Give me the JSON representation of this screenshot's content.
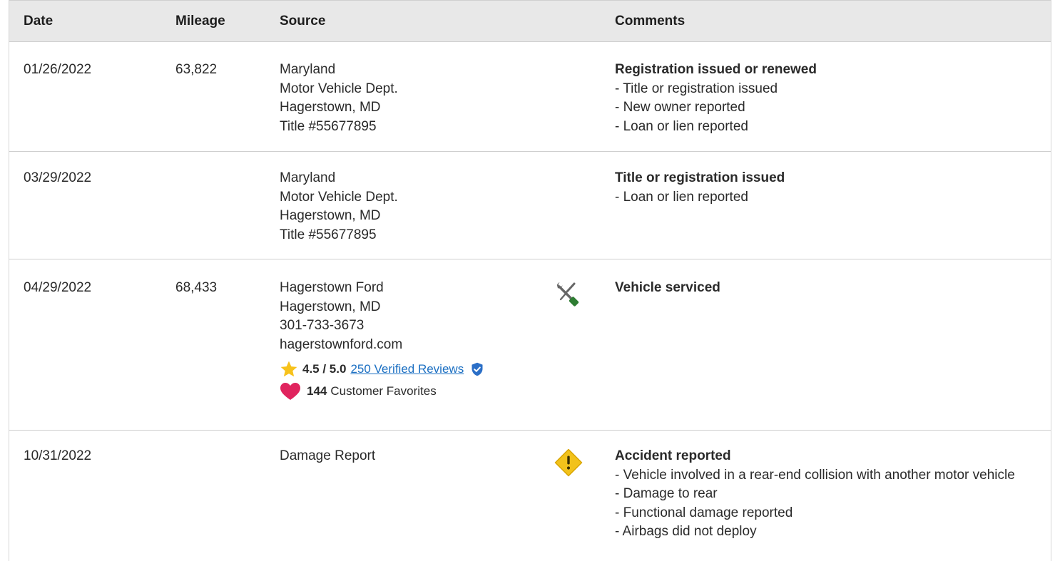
{
  "header": {
    "date": "Date",
    "mileage": "Mileage",
    "source": "Source",
    "comments": "Comments"
  },
  "rows": [
    {
      "date": "01/26/2022",
      "mileage": "63,822",
      "source": [
        "Maryland",
        "Motor Vehicle Dept.",
        "Hagerstown, MD",
        "Title #55677895"
      ],
      "comment_title": "Registration issued or renewed",
      "comment_items": [
        "- Title or registration issued",
        "- New owner reported",
        "- Loan or lien reported"
      ]
    },
    {
      "date": "03/29/2022",
      "mileage": "",
      "source": [
        "Maryland",
        "Motor Vehicle Dept.",
        "Hagerstown, MD",
        "Title #55677895"
      ],
      "comment_title": "Title or registration issued",
      "comment_items": [
        "- Loan or lien reported"
      ]
    },
    {
      "date": "04/29/2022",
      "mileage": "68,433",
      "source": [
        "Hagerstown Ford",
        "Hagerstown, MD",
        "301-733-3673",
        "hagerstownford.com"
      ],
      "icon": "service-wrench-screwdriver-icon",
      "rating": {
        "score": "4.5 / 5.0",
        "reviews_link": "250 Verified Reviews",
        "favorites_count": "144",
        "favorites_label": "Customer Favorites"
      },
      "comment_title": "Vehicle serviced",
      "comment_items": []
    },
    {
      "date": "10/31/2022",
      "mileage": "",
      "source": [
        "Damage Report"
      ],
      "icon": "warning-diamond-icon",
      "comment_title": "Accident reported",
      "comment_items": [
        "- Vehicle involved in a rear-end collision with another motor vehicle",
        "- Damage to rear",
        "- Functional damage reported",
        "- Airbags did not deploy"
      ]
    }
  ],
  "colors": {
    "header_bg": "#e8e8e8",
    "link": "#1b6fc2",
    "star": "#f7c21b",
    "heart": "#e0245e",
    "verified": "#2b6fc7",
    "warning": "#f2c21b",
    "wrench_green": "#2e7d32"
  }
}
